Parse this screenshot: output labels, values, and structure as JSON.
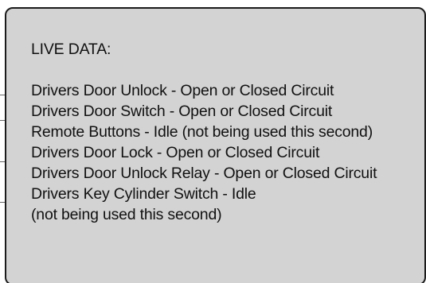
{
  "panel": {
    "heading": "LIVE DATA:",
    "lines": [
      "Drivers Door Unlock - Open or Closed Circuit",
      "Drivers Door Switch - Open or Closed Circuit",
      "Remote Buttons - Idle (not being used this second)",
      "Drivers Door Lock - Open or Closed Circuit",
      "Drivers Door Unlock Relay - Open or Closed Circuit",
      "Drivers Key Cylinder Switch - Idle",
      "(not being used this second)"
    ]
  },
  "colors": {
    "panel_background": "#d3d3d3",
    "panel_border": "#1b1b1b",
    "text": "#111111"
  }
}
